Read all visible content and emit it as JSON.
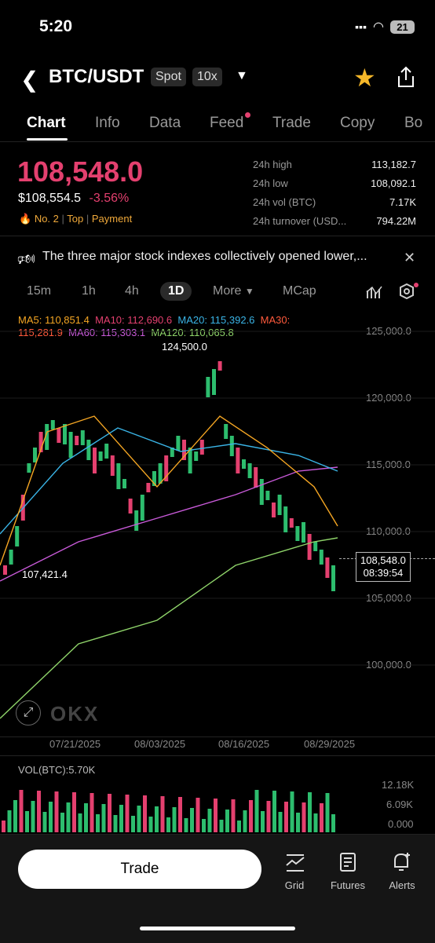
{
  "status": {
    "time": "5:20",
    "battery": "21"
  },
  "header": {
    "pair": "BTC/USDT",
    "market": "Spot",
    "leverage": "10x"
  },
  "tabs": [
    "Chart",
    "Info",
    "Data",
    "Feed",
    "Trade",
    "Copy",
    "Bo"
  ],
  "price": {
    "last": "108,548.0",
    "usd": "$108,554.5",
    "change": "-3.56%"
  },
  "ribbon": {
    "rank": "No. 2",
    "tag1": "Top",
    "tag2": "Payment"
  },
  "stats": [
    {
      "label": "24h high",
      "value": "113,182.7"
    },
    {
      "label": "24h low",
      "value": "108,092.1"
    },
    {
      "label": "24h vol (BTC)",
      "value": "7.17K"
    },
    {
      "label": "24h turnover (USD...",
      "value": "794.22M"
    }
  ],
  "news": {
    "text": "The three major stock indexes collectively opened lower,..."
  },
  "intervals": {
    "items": [
      "15m",
      "1h",
      "4h",
      "1D",
      "More",
      "MCap"
    ],
    "active": "1D"
  },
  "ma_legend": [
    {
      "label": "MA5: 110,851.4",
      "color": "#f5a623"
    },
    {
      "label": "MA10: 112,690.6",
      "color": "#e4406f"
    },
    {
      "label": "MA20: 115,392.6",
      "color": "#3ab4e6"
    },
    {
      "label": "MA30:",
      "color": "#ff5a3c"
    },
    {
      "label": "115,281.9",
      "color": "#ff5a3c"
    },
    {
      "label": "MA60: 115,303.1",
      "color": "#c95ad9"
    },
    {
      "label": "MA120: 110,065.8",
      "color": "#8fd46a"
    }
  ],
  "chart_data": {
    "type": "candlestick",
    "price_axis": [
      "125,000.0",
      "120,000.0",
      "115,000.0",
      "110,000.0",
      "105,000.0",
      "100,000.0"
    ],
    "ylim": [
      97000,
      127000
    ],
    "date_ticks": [
      "07/21/2025",
      "08/03/2025",
      "08/16/2025",
      "08/29/2025"
    ],
    "annotations": {
      "high": "124,500.0",
      "low": "107,421.4",
      "last_price": "108,548.0",
      "countdown": "08:39:54"
    },
    "volume": {
      "label": "VOL(BTC):5.70K",
      "axis": [
        "12.18K",
        "6.09K",
        "0.000"
      ]
    }
  },
  "bottom": {
    "trade": "Trade",
    "items": [
      "Grid",
      "Futures",
      "Alerts"
    ]
  }
}
